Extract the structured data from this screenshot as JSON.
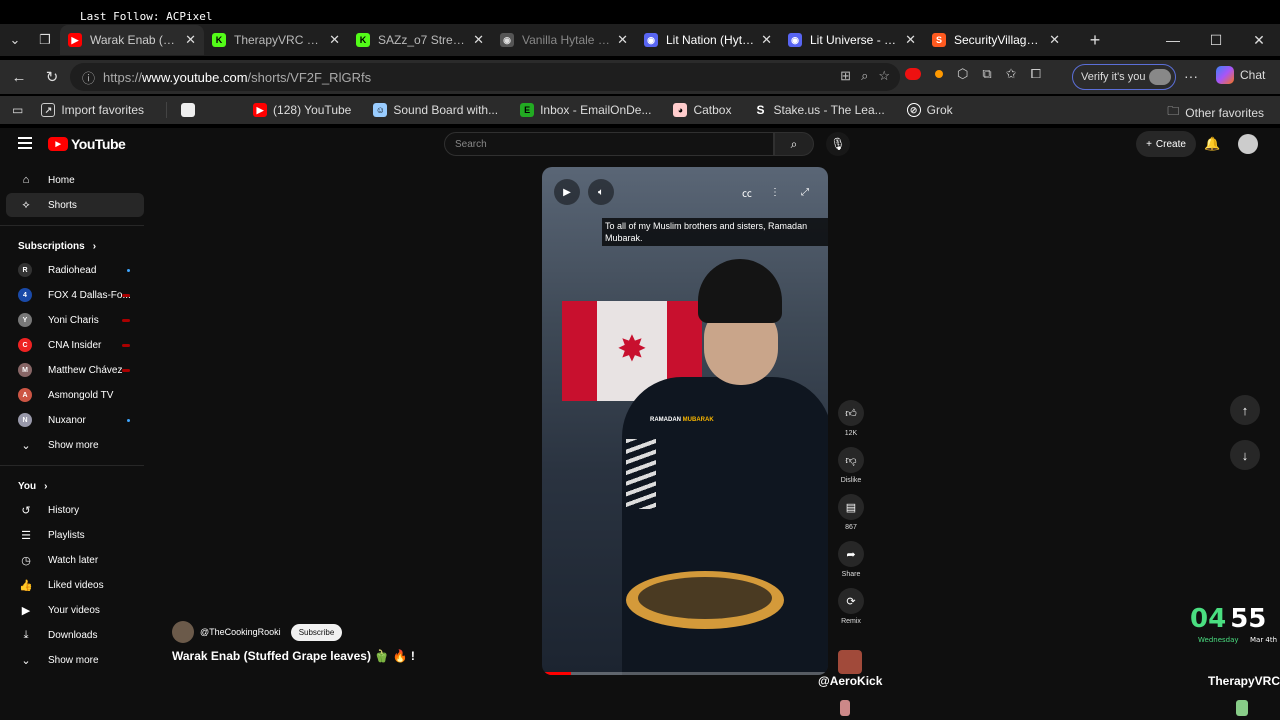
{
  "overlay": {
    "last_follow": "Last Follow: ACPixel"
  },
  "tabs": [
    {
      "title": "Warak Enab (Stuffe",
      "icon": "youtube-icon",
      "color": "#ff0000",
      "active": true
    },
    {
      "title": "TherapyVRC Strea",
      "icon": "kick-icon",
      "color": "#53fc18"
    },
    {
      "title": "SAZz_o7 Stream -",
      "icon": "kick-icon",
      "color": "#53fc18"
    },
    {
      "title": "Vanilla Hytale SMP",
      "icon": "discord-icon",
      "color": "#5865f2"
    },
    {
      "title": "Lit Nation (Hytale",
      "icon": "discord-icon",
      "color": "#5865f2"
    },
    {
      "title": "Lit Universe - Disc",
      "icon": "discord-icon",
      "color": "#5865f2"
    },
    {
      "title": "SecurityVillagers -",
      "icon": "security-icon",
      "color": "#ff5a1f"
    }
  ],
  "address": {
    "prefix": "https://",
    "host": "www.youtube.com",
    "path": "/shorts/VF2F_RlGRfs",
    "verify_label": "Verify it's you",
    "chat_label": "Chat"
  },
  "bookmarks": [
    {
      "label": "Import favorites",
      "icon": "import-icon"
    },
    {
      "label": "",
      "icon": "blank-page-icon"
    },
    {
      "label": "(128) YouTube",
      "icon": "youtube-icon"
    },
    {
      "label": "Sound Board with...",
      "icon": "soundboard-icon"
    },
    {
      "label": "Inbox - EmailOnDe...",
      "icon": "email-icon"
    },
    {
      "label": "Catbox",
      "icon": "catbox-icon"
    },
    {
      "label": "Stake.us - The Lea...",
      "icon": "stake-icon"
    },
    {
      "label": "Grok",
      "icon": "grok-icon"
    }
  ],
  "other_favorites": "Other favorites",
  "youtube": {
    "logo_text": "YouTube",
    "search_placeholder": "Search",
    "create_label": "Create",
    "nav": [
      {
        "label": "Home",
        "icon": "home-icon"
      },
      {
        "label": "Shorts",
        "icon": "shorts-icon"
      }
    ],
    "subscriptions_label": "Subscriptions",
    "subscriptions": [
      {
        "label": "Radiohead",
        "color": "#333",
        "dot": "blue"
      },
      {
        "label": "FOX 4 Dallas-Fo...",
        "color": "#1a4aa8",
        "dot": "red"
      },
      {
        "label": "Yoni Charis",
        "color": "#777",
        "dot": "red"
      },
      {
        "label": "CNA Insider",
        "color": "#e22",
        "dot": "red"
      },
      {
        "label": "Matthew Chávez",
        "color": "#866",
        "dot": "red"
      },
      {
        "label": "Asmongold TV",
        "color": "#c54",
        "dot": ""
      },
      {
        "label": "Nuxanor",
        "color": "#99a",
        "dot": "blue"
      }
    ],
    "show_more": "Show more",
    "you_label": "You",
    "you_items": [
      {
        "label": "History",
        "icon": "history-icon"
      },
      {
        "label": "Playlists",
        "icon": "playlists-icon"
      },
      {
        "label": "Watch later",
        "icon": "watch-later-icon"
      },
      {
        "label": "Liked videos",
        "icon": "like-icon"
      },
      {
        "label": "Your videos",
        "icon": "your-videos-icon"
      },
      {
        "label": "Downloads",
        "icon": "download-icon"
      }
    ],
    "show_more_2": "Show more",
    "video": {
      "caption": "To all of my Muslim brothers and sisters, Ramadan Mubarak.",
      "overlay_text_1": "RAMADAN",
      "overlay_text_2": "MUBARAK",
      "progress": 0.1
    },
    "actions": [
      {
        "label": "12K",
        "icon": "like-icon"
      },
      {
        "label": "Dislike",
        "icon": "dislike-icon"
      },
      {
        "label": "867",
        "icon": "comment-icon"
      },
      {
        "label": "Share",
        "icon": "share-icon"
      },
      {
        "label": "Remix",
        "icon": "remix-icon"
      }
    ],
    "channel_handle": "@TheCookingRooki",
    "subscribe_label": "Subscribe",
    "short_title": "Warak Enab (Stuffed Grape leaves) 🫑 🔥 !"
  },
  "stream": {
    "clock_hours": "04",
    "clock_minutes": "55",
    "clock_day": "Wednesday",
    "clock_date": "Mar 4th",
    "nick_left": "@AeroKick",
    "nick_right": "TherapyVRC"
  }
}
